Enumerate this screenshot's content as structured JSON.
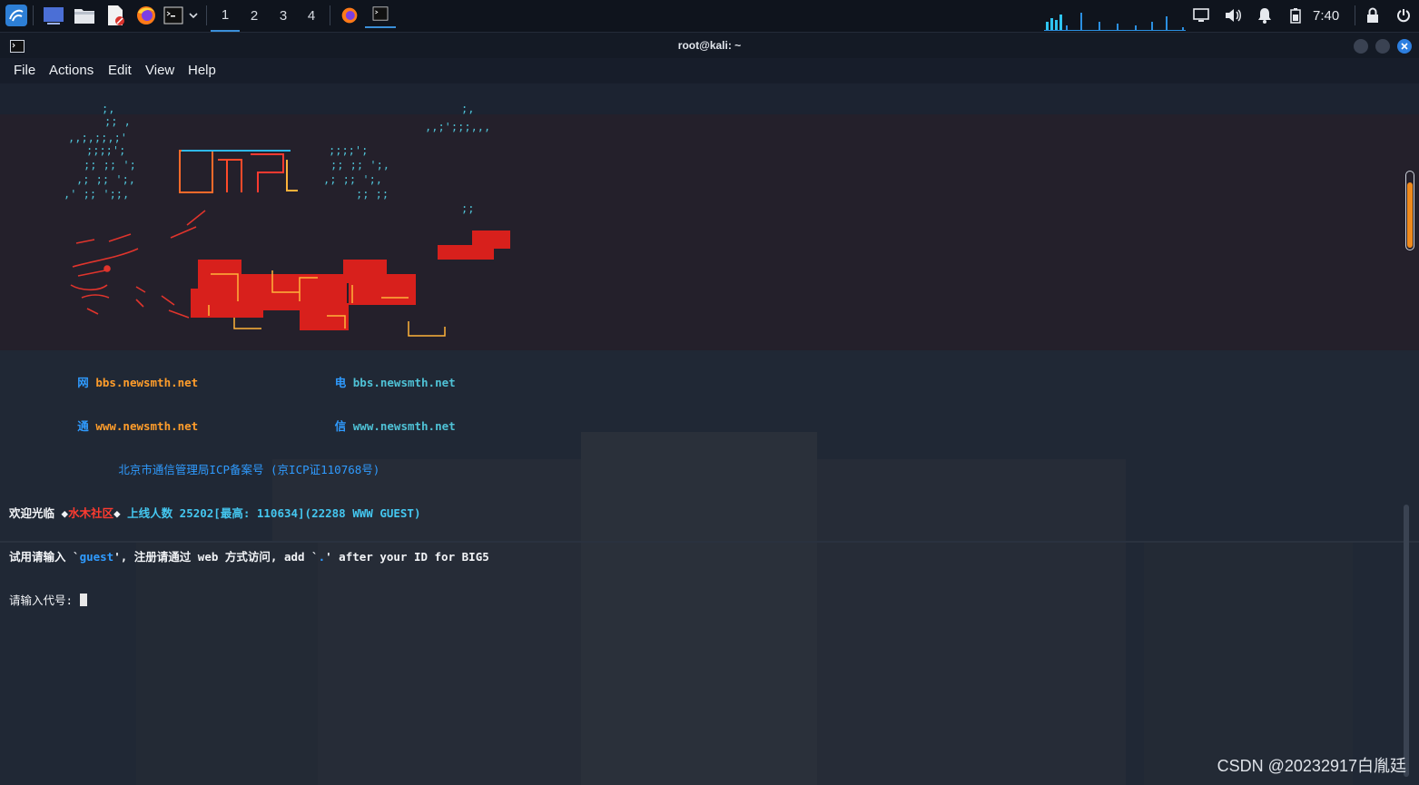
{
  "panel": {
    "workspaces": [
      "1",
      "2",
      "3",
      "4"
    ],
    "active_workspace": "1",
    "clock": "7:40",
    "icons": [
      "kali-menu-icon",
      "desktop-icon",
      "file-manager-icon",
      "text-editor-icon",
      "firefox-icon",
      "terminal-icon",
      "chevron-down-icon",
      "firefox-icon",
      "terminal-icon",
      "network-icon",
      "volume-icon",
      "notification-bell-icon",
      "battery-icon",
      "lock-icon",
      "power-icon"
    ]
  },
  "window": {
    "title": "root@kali: ~",
    "menu": [
      "File",
      "Actions",
      "Edit",
      "View",
      "Help"
    ]
  },
  "terminal": {
    "wangtong_label": "网",
    "tong_label": "通",
    "dian_label": "电",
    "xin_label": "信",
    "wt_bbs": "bbs.newsmth.net",
    "wt_www": "www.newsmth.net",
    "dx_bbs": "bbs.newsmth.net",
    "dx_www": "www.newsmth.net",
    "icp": "北京市通信管理局ICP备案号 (京ICP证110768号)",
    "welcome_prefix": "欢迎光临 ◆",
    "site_name": "水木社区",
    "welcome_mid": "◆ ",
    "online_text": "上线人数 25202[最高: 110634](22288 WWW GUEST)",
    "guest_prefix": "试用请输入 `",
    "guest_word": "guest",
    "guest_suffix": "', 注册请通过 web 方式访问, add `",
    "dot": ".",
    "big5_suffix": "' after your ID for BIG5",
    "prompt": "请输入代号: "
  },
  "watermark": "CSDN @20232917白胤廷",
  "colors": {
    "accent_blue": "#2f9bff",
    "orange": "#ff9d2b",
    "red": "#ff3b30",
    "scroll_orange": "#f08a1c"
  }
}
